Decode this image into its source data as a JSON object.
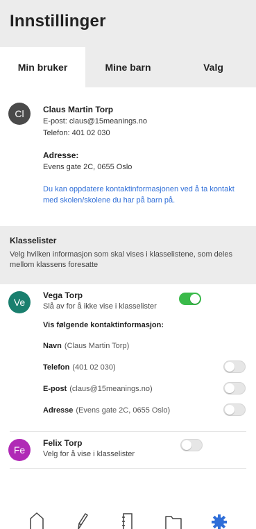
{
  "header": {
    "title": "Innstillinger"
  },
  "tabs": [
    {
      "label": "Min bruker",
      "active": true
    },
    {
      "label": "Mine barn",
      "active": false
    },
    {
      "label": "Valg",
      "active": false
    }
  ],
  "profile": {
    "initials": "Cl",
    "name": "Claus Martin Torp",
    "email_line": "E-post: claus@15meanings.no",
    "phone_line": "Telefon: 401 02 030",
    "address_label": "Adresse:",
    "address": "Evens gate 2C, 0655 Oslo",
    "info_text": "Du kan oppdatere kontaktinformasjonen ved å ta kontakt med skolen/skolene du har på barn på.",
    "avatar_color": "#4a4a4a",
    "link_color": "#2f6ed8"
  },
  "klasselister": {
    "title": "Klasselister",
    "description": "Velg hvilken informasjon som skal vises i klasselistene, som deles mellom klassens foresatte"
  },
  "children": [
    {
      "initials": "Ve",
      "name": "Vega Torp",
      "subtitle": "Slå av for å ikke vise i klasselister",
      "avatar_color": "#1a7f6e",
      "visible": true,
      "contact_title": "Vis følgende kontaktinformasjon:",
      "contacts": [
        {
          "label": "Navn",
          "value": "(Claus Martin Torp)",
          "has_toggle": false
        },
        {
          "label": "Telefon",
          "value": "(401 02 030)",
          "has_toggle": true,
          "enabled": false
        },
        {
          "label": "E-post",
          "value": "(claus@15meanings.no)",
          "has_toggle": true,
          "enabled": false
        },
        {
          "label": "Adresse",
          "value": "(Evens gate 2C, 0655 Oslo)",
          "has_toggle": true,
          "enabled": false
        }
      ]
    },
    {
      "initials": "Fe",
      "name": "Felix Torp",
      "subtitle": "Velg for å vise i klasselister",
      "avatar_color": "#b02ab6",
      "visible": false
    }
  ],
  "nav": [
    {
      "icon": "home-icon"
    },
    {
      "icon": "pencil-icon"
    },
    {
      "icon": "notebook-icon"
    },
    {
      "icon": "folder-icon"
    },
    {
      "icon": "gear-icon",
      "active": true
    }
  ],
  "colors": {
    "accent": "#2f6ed8",
    "toggle_on": "#3aba4a",
    "header_bg": "#ececec"
  }
}
